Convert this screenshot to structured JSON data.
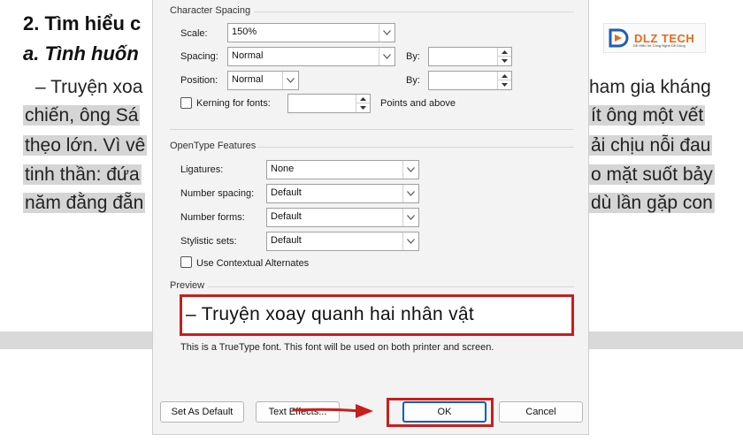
{
  "document": {
    "heading": "2. Tìm hiểu c",
    "subheading": "a. Tình huốn",
    "left_lines": [
      "– Truyện xoa",
      "chiến, ông Sá",
      "thẹo lớn. Vì vê",
      "tinh thần: đứa",
      "năm đằng đẵn"
    ],
    "right_lines": [
      "ham gia kháng",
      "ít ông một vết",
      "ải chịu nỗi đau",
      "o mặt suốt bảy",
      "dù lần gặp con"
    ],
    "logo_text": "DLZ TECH",
    "logo_subtext": "Dễ Hiểu Về Công Nghệ Dễ Dùng",
    "colors": {
      "highlight": "#d5d5d5",
      "logo": "#e36a1a"
    }
  },
  "dialog": {
    "character_spacing": {
      "title": "Character Spacing",
      "scale": {
        "label": "Scale:",
        "value": "150%"
      },
      "spacing": {
        "label": "Spacing:",
        "value": "Normal",
        "by_label": "By:",
        "by_value": ""
      },
      "position": {
        "label": "Position:",
        "value": "Normal",
        "by_label": "By:",
        "by_value": ""
      },
      "kerning": {
        "label": "Kerning for fonts:",
        "checked": false,
        "value": "",
        "suffix": "Points and above"
      }
    },
    "opentype": {
      "title": "OpenType Features",
      "ligatures": {
        "label": "Ligatures:",
        "value": "None"
      },
      "number_spacing": {
        "label": "Number spacing:",
        "value": "Default"
      },
      "number_forms": {
        "label": "Number forms:",
        "value": "Default"
      },
      "stylistic_sets": {
        "label": "Stylistic sets:",
        "value": "Default"
      },
      "contextual_alternates": {
        "label": "Use Contextual Alternates",
        "checked": false
      }
    },
    "preview": {
      "title": "Preview",
      "sample": "– Truyện xoay quanh hai nhân vật",
      "note": "This is a TrueType font. This font will be used on both printer and screen."
    },
    "buttons": {
      "set_default": "Set As Default",
      "text_effects": "Text Effects...",
      "ok": "OK",
      "cancel": "Cancel"
    },
    "colors": {
      "annotation": "#c81e1e",
      "focus": "#005fb8"
    }
  }
}
